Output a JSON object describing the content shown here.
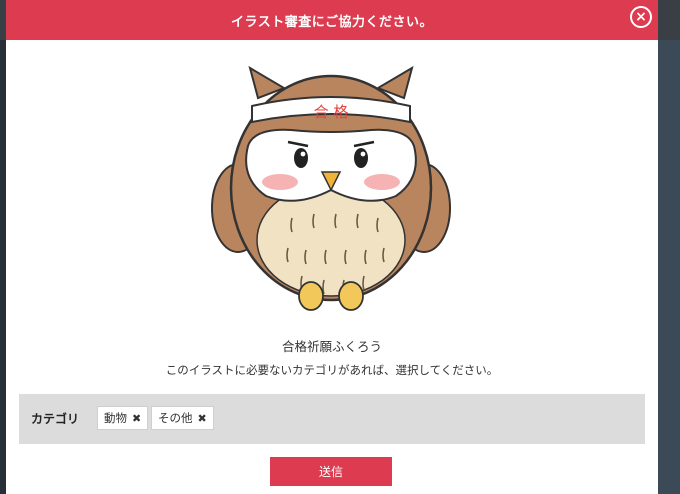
{
  "modal": {
    "title": "イラスト審査にご協力ください。",
    "close_icon": "×",
    "illustration": {
      "name": "合格祈願ふくろう",
      "headband_text": "合 格"
    },
    "description": "このイラストに必要ないカテゴリがあれば、選択してください。",
    "category": {
      "label": "カテゴリ",
      "tags": [
        {
          "label": "動物",
          "remove_icon": "✖"
        },
        {
          "label": "その他",
          "remove_icon": "✖"
        }
      ]
    },
    "submit_label": "送信"
  },
  "colors": {
    "accent": "#dc3b50",
    "panel": "#dcdcdc"
  }
}
